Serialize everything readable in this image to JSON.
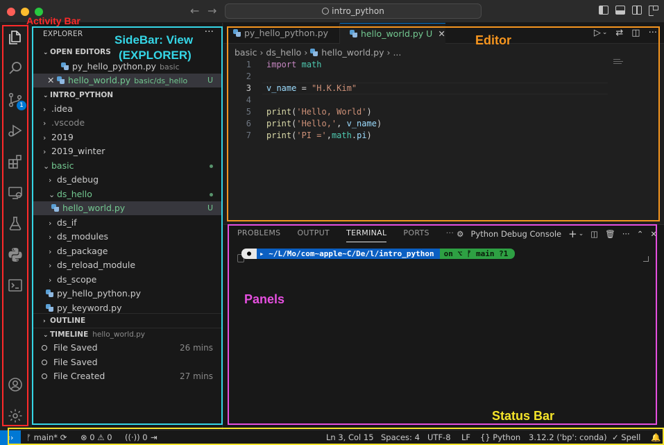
{
  "window": {
    "search_text": "intro_python"
  },
  "activity_bar": {
    "scm_badge": "1"
  },
  "sidebar": {
    "title": "EXPLORER",
    "more": "···",
    "open_editors": {
      "header": "OPEN EDITORS",
      "items": [
        {
          "name": "py_hello_python.py",
          "desc": "basic"
        },
        {
          "name": "hello_world.py",
          "desc": "basic/ds_hello",
          "status": "U"
        }
      ]
    },
    "project": {
      "header": "INTRO_PYTHON",
      "items": [
        {
          "name": ".idea"
        },
        {
          "name": ".vscode"
        },
        {
          "name": "2019"
        },
        {
          "name": "2019_winter"
        },
        {
          "name": "basic"
        },
        {
          "name": "ds_debug"
        },
        {
          "name": "ds_hello"
        },
        {
          "name": "hello_world.py",
          "status": "U"
        },
        {
          "name": "ds_if"
        },
        {
          "name": "ds_modules"
        },
        {
          "name": "ds_package"
        },
        {
          "name": "ds_reload_module"
        },
        {
          "name": "ds_scope"
        },
        {
          "name": "py_hello_python.py"
        },
        {
          "name": "py_keyword.py"
        }
      ]
    },
    "outline": {
      "header": "OUTLINE"
    },
    "timeline": {
      "header": "TIMELINE",
      "file": "hello_world.py",
      "items": [
        {
          "label": "File Saved",
          "time": "26 mins"
        },
        {
          "label": "File Saved",
          "time": ""
        },
        {
          "label": "File Created",
          "time": "27 mins"
        }
      ]
    }
  },
  "editor": {
    "tabs": [
      {
        "name": "py_hello_python.py"
      },
      {
        "name": "hello_world.py",
        "status": "U"
      }
    ],
    "breadcrumb": {
      "part1": "basic",
      "part2": "ds_hello",
      "part3": "hello_world.py",
      "part4": "..."
    },
    "line_numbers": [
      "1",
      "2",
      "3",
      "4",
      "5",
      "6",
      "7"
    ],
    "code": {
      "l1_kw": "import",
      "l1_mod": "math",
      "l3_var": "v_name",
      "l3_op": " = ",
      "l3_str": "\"H.K.Kim\"",
      "l5_fn": "print",
      "l5_str": "'Hello, World'",
      "l6_fn": "print",
      "l6_str": "'Hello,'",
      "l6_var": "v_name",
      "l7_fn": "print",
      "l7_str": "'PI ='",
      "l7_mod": "math",
      "l7_var": "pi"
    }
  },
  "panel": {
    "tabs": [
      "PROBLEMS",
      "OUTPUT",
      "TERMINAL",
      "PORTS"
    ],
    "more": "···",
    "debug_console": "Python Debug Console",
    "prompt_path": "~/L/Mo/com~apple~C/De/l/intro_python",
    "prompt_git": "on ⌥ ᚠ main ?1"
  },
  "status_bar": {
    "branch": "main*",
    "problems": "⊗ 0 ⚠ 0",
    "ports": "0",
    "position": "Ln 3, Col 15",
    "spaces": "Spaces: 4",
    "encoding": "UTF-8",
    "eol": "LF",
    "language": "Python",
    "interpreter": "3.12.2 ('bp': conda)",
    "spell": "Spell"
  },
  "annotations": {
    "activity_bar": "Activity Bar",
    "sidebar_line1": "SideBar: View",
    "sidebar_line2": "(EXPLORER)",
    "editor": "Editor",
    "panels": "Panels",
    "status_bar": "Status Bar",
    "colors": {
      "activity": "#ff2a2a",
      "sidebar": "#35d6e6",
      "editor": "#f5951f",
      "panels": "#e64fe0",
      "status": "#f4e42a"
    }
  }
}
